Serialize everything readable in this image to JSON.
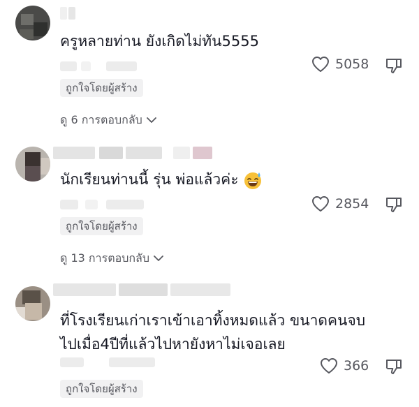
{
  "comments": [
    {
      "text": "ครูหลายท่าน ยังเกิดไม่ทัน5555",
      "likes": "5058",
      "creator_badge": "ถูกใจโดยผู้สร้าง",
      "replies": "ดู 6 การตอบกลับ"
    },
    {
      "text": "นักเรียนท่านนี้ รุ่น พ่อแล้วค่ะ",
      "likes": "2854",
      "creator_badge": "ถูกใจโดยผู้สร้าง",
      "replies": "ดู 13 การตอบกลับ"
    },
    {
      "text_line1": "ที่โรงเรียนเก่าเราเข้าเอาทิ้งหมดแล้ว ขนาดคนจบ",
      "text_line2": "ไปเมื่อ4ปีที่แล้วไปหายังหาไม่เจอเลย",
      "likes": "366",
      "creator_badge": "ถูกใจโดยผู้สร้าง"
    }
  ],
  "icons": {
    "like": "heart-outline-icon",
    "dislike": "thumbs-down-icon",
    "expand": "chevron-down-icon",
    "emoji": "sweat-smile-emoji"
  },
  "colors": {
    "text": "#161823",
    "secondary": "#57585f",
    "badge_bg": "#f1f1f2"
  }
}
